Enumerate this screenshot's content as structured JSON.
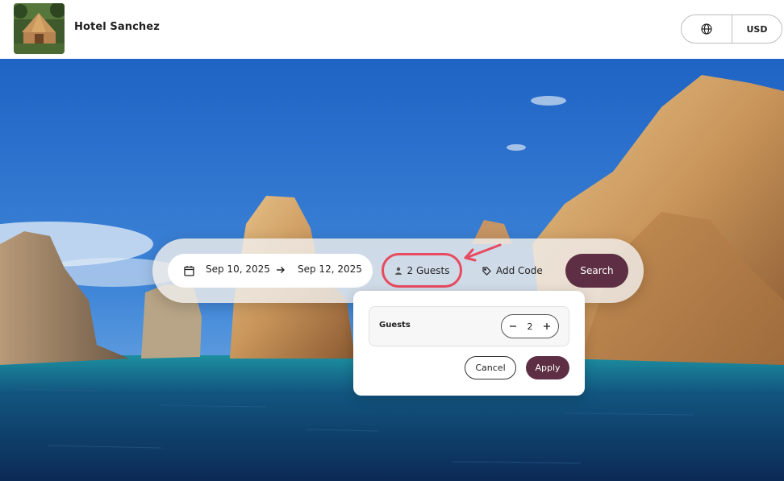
{
  "header": {
    "hotel_name": "Hotel Sanchez",
    "language_icon": "globe-icon",
    "currency": "USD"
  },
  "search": {
    "check_in": "Sep 10, 2025",
    "check_out": "Sep 12, 2025",
    "guests_label": "2 Guests",
    "code_label": "Add Code",
    "search_label": "Search"
  },
  "guests_dropdown": {
    "label": "Guests",
    "count": "2",
    "cancel_label": "Cancel",
    "apply_label": "Apply"
  },
  "colors": {
    "accent": "#5e2f44",
    "highlight": "#e84a5f"
  }
}
